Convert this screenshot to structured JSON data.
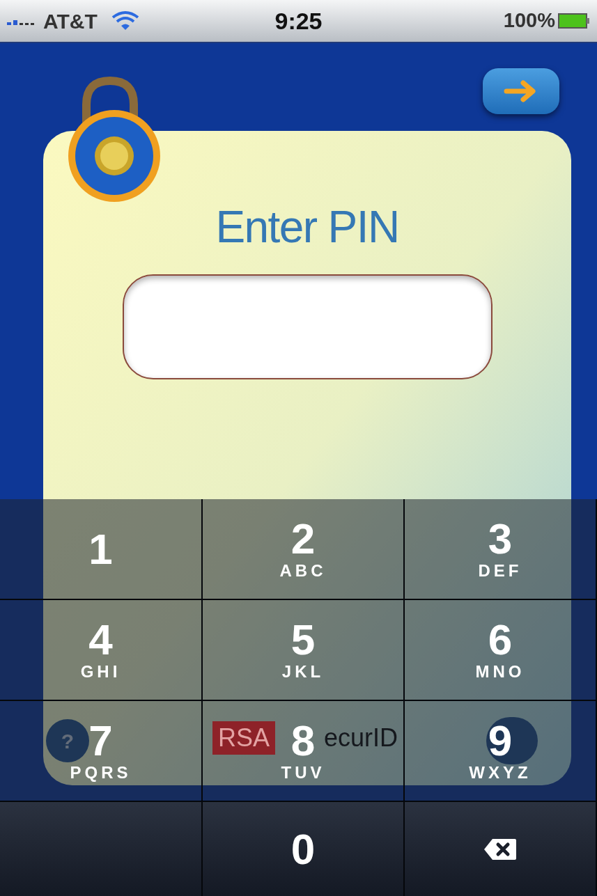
{
  "status_bar": {
    "carrier": "AT&T",
    "time": "9:25",
    "battery": "100%"
  },
  "title": "Enter PIN",
  "help_button": {
    "label": "?"
  },
  "logo": {
    "badge": "RSA",
    "text": "ecurID"
  },
  "keypad": [
    {
      "kind": "digit",
      "digit": "1"
    },
    {
      "kind": "digit",
      "digit": "2",
      "letters": "ABC"
    },
    {
      "kind": "digit",
      "digit": "3",
      "letters": "DEF"
    },
    {
      "kind": "digit",
      "digit": "4",
      "letters": "GHI"
    },
    {
      "kind": "digit",
      "digit": "5",
      "letters": "JKL"
    },
    {
      "kind": "digit",
      "digit": "6",
      "letters": "MNO"
    },
    {
      "kind": "digit",
      "digit": "7",
      "letters": "PQRS"
    },
    {
      "kind": "digit",
      "digit": "8",
      "letters": "TUV"
    },
    {
      "kind": "digit",
      "digit": "9",
      "letters": "WXYZ"
    },
    {
      "kind": "blank"
    },
    {
      "kind": "digit",
      "digit": "0"
    },
    {
      "kind": "delete"
    }
  ]
}
